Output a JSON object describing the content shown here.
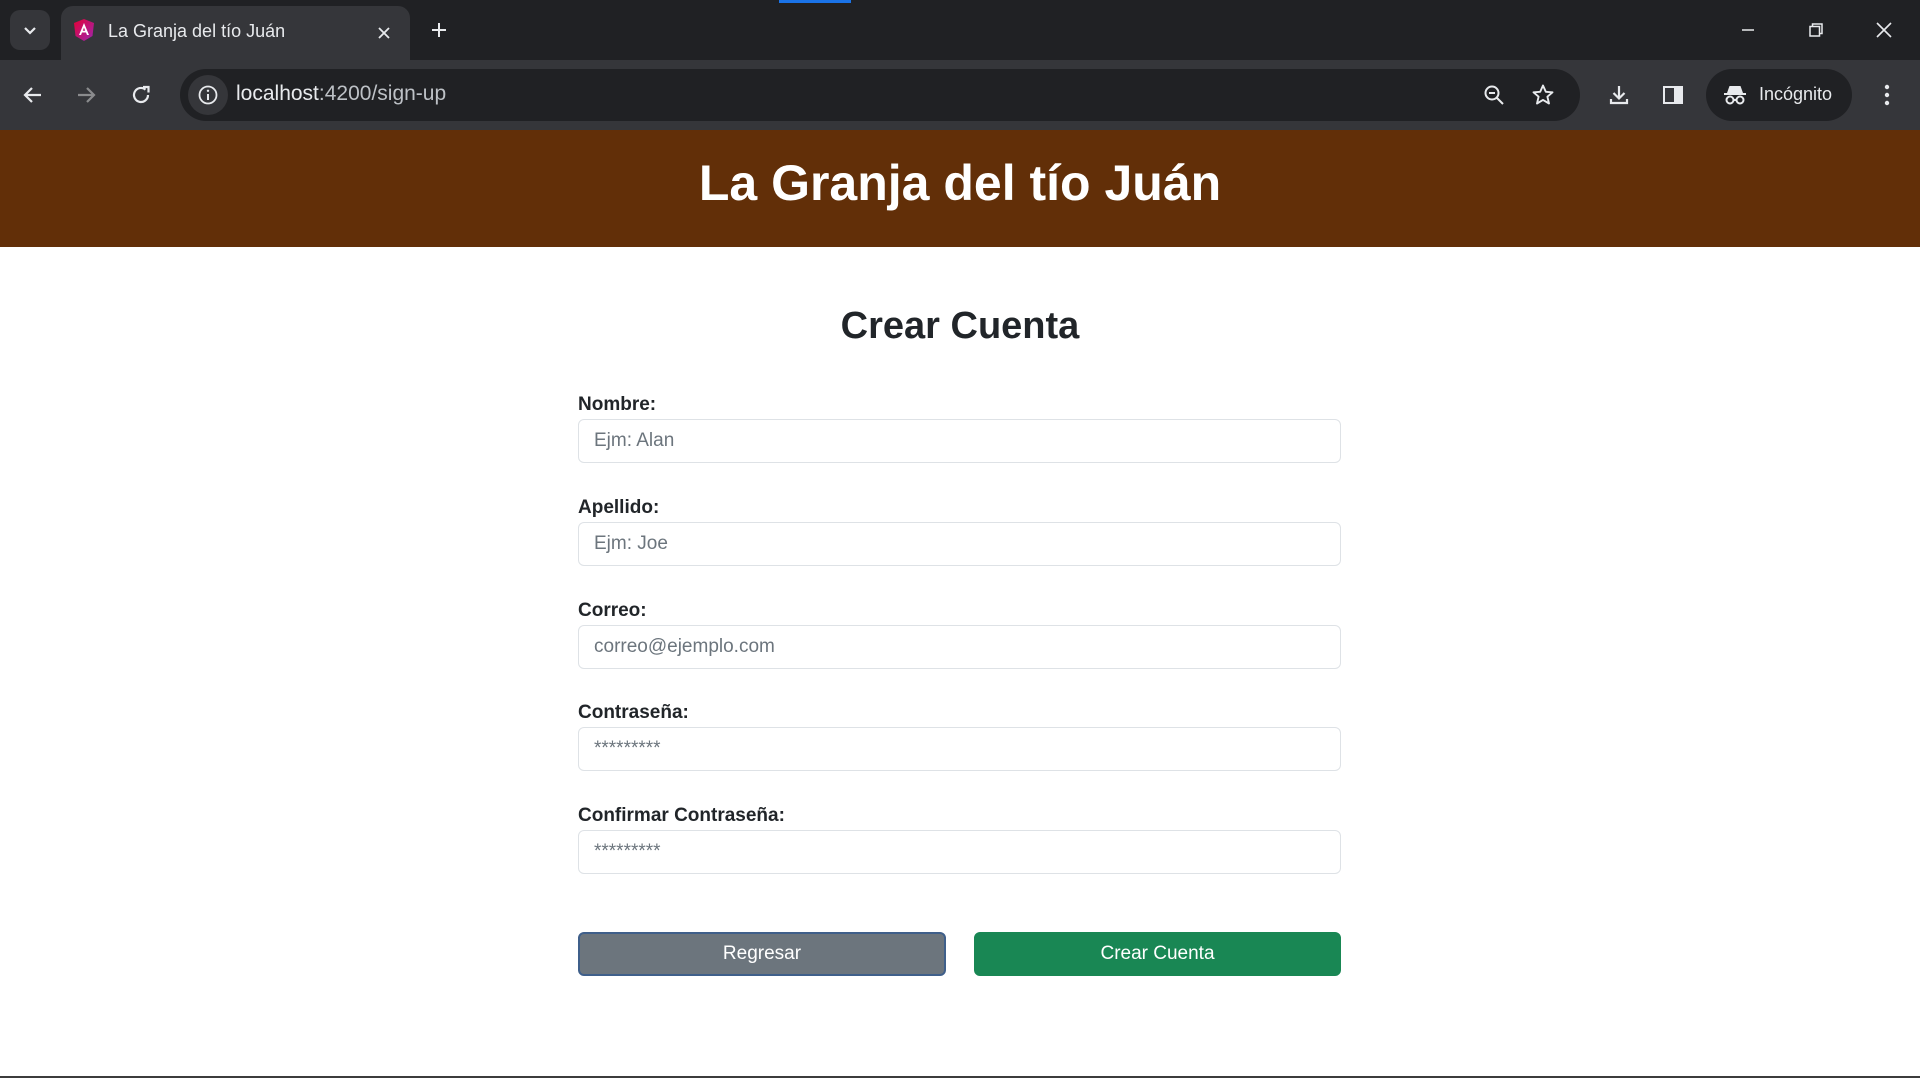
{
  "browser": {
    "tab": {
      "title": "La Granja del tío Juán",
      "favicon": "angular-icon"
    },
    "url": {
      "host": "localhost",
      "path": ":4200/sign-up"
    },
    "profile_label": "Incógnito"
  },
  "header": {
    "site_title": "La Granja del tío Juán",
    "background": "#622f08"
  },
  "form": {
    "title": "Crear Cuenta",
    "fields": [
      {
        "label": "Nombre:",
        "placeholder": "Ejm: Alan",
        "value": ""
      },
      {
        "label": "Apellido:",
        "placeholder": "Ejm: Joe",
        "value": ""
      },
      {
        "label": "Correo:",
        "placeholder": "correo@ejemplo.com",
        "value": ""
      },
      {
        "label": "Contraseña:",
        "placeholder": "*********",
        "value": ""
      },
      {
        "label": "Confirmar Contraseña:",
        "placeholder": "*********",
        "value": ""
      }
    ],
    "buttons": {
      "back_label": "Regresar",
      "create_label": "Crear Cuenta"
    }
  },
  "colors": {
    "back_button": "#6c757d",
    "create_button": "#198754"
  }
}
